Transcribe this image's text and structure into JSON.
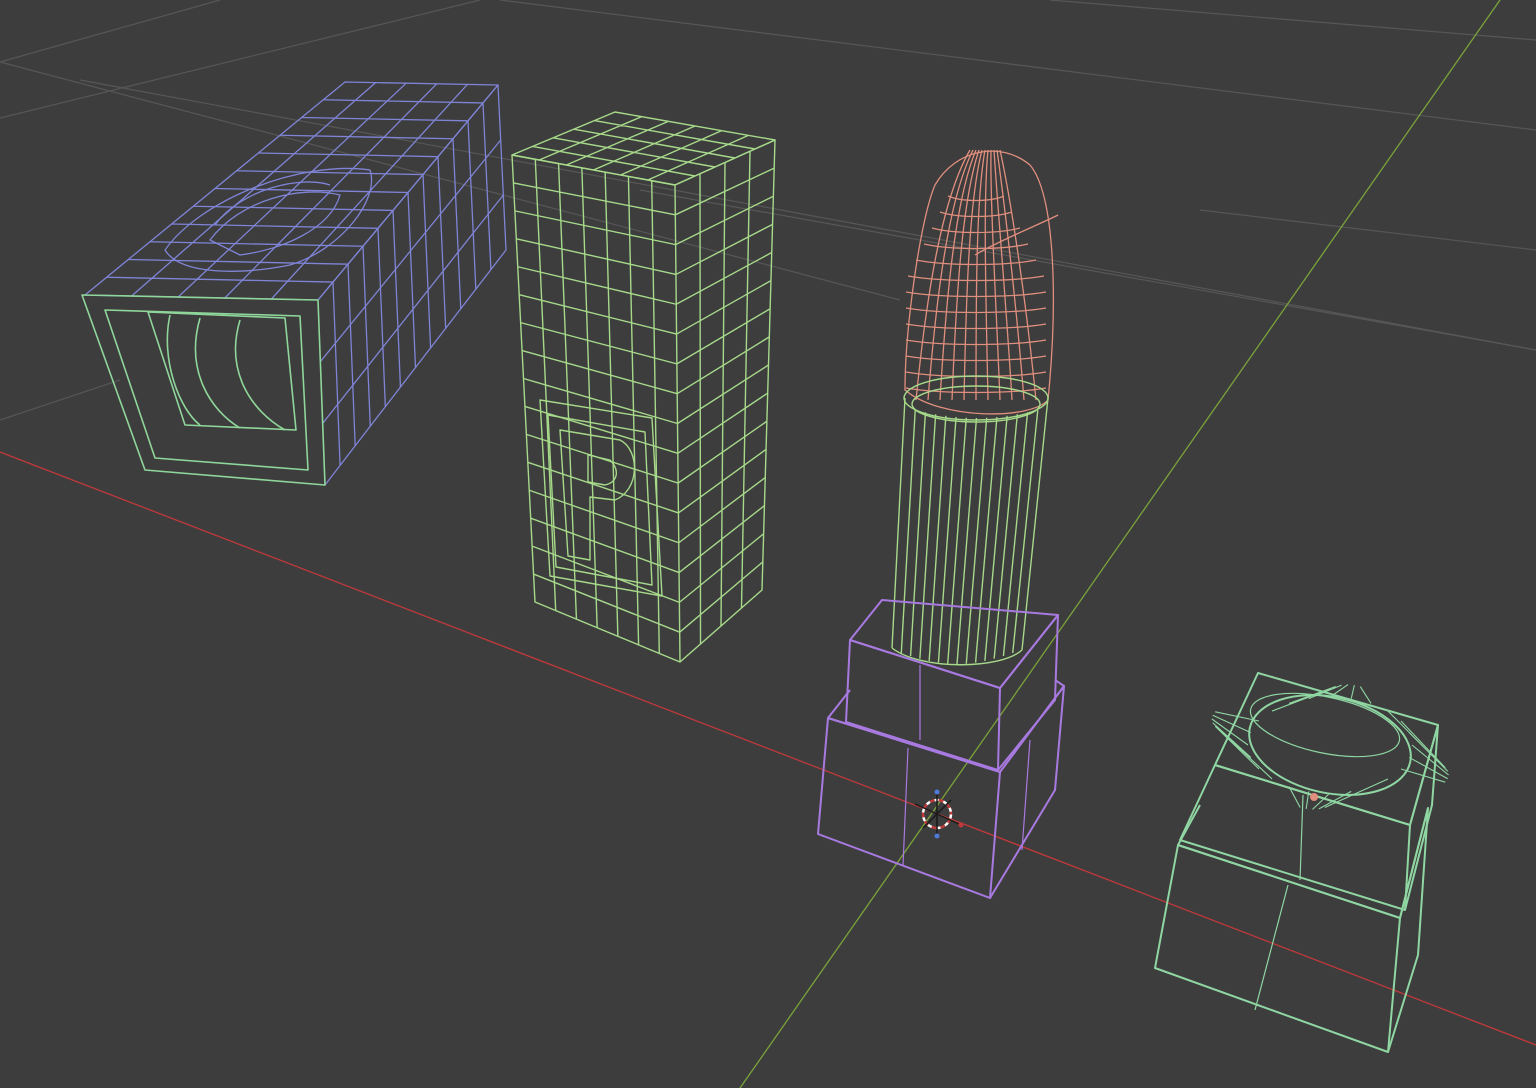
{
  "viewport": {
    "background": "#3d3d3d",
    "grid_color": "#575757",
    "x_axis_color": "#c0393b",
    "y_axis_color": "#7aa33a"
  },
  "objects": [
    {
      "name": "case-lying",
      "wire_color": "#7f84d6",
      "rim_color": "#8fd69a",
      "logo_letter": "P"
    },
    {
      "name": "case-standing",
      "wire_color": "#a6d98a",
      "logo_letter": "P"
    },
    {
      "name": "lipstick",
      "tip_color": "#e08f7e",
      "tube_color": "#a6d98a",
      "base_color": "#a87ae0"
    },
    {
      "name": "base-cap",
      "wire_color": "#8fd6a3"
    }
  ],
  "icons": {
    "origin": "object-origin-icon",
    "selection": "selection-dot-icon"
  }
}
